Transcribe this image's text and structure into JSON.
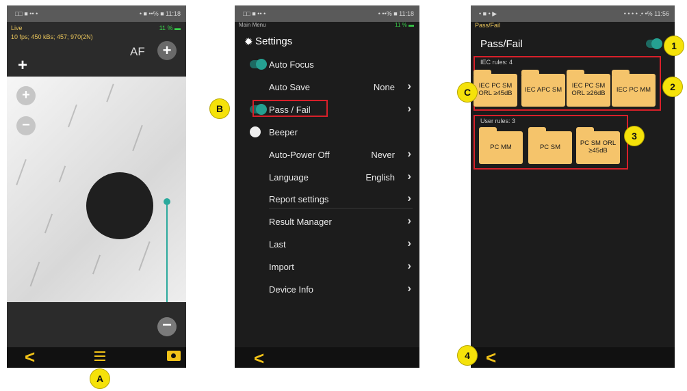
{
  "phoneA": {
    "status_left": "□□ ■ •• •",
    "status_right": "• ■ ••% ■ 11:18",
    "live_label": "Live",
    "battery": "11 % ▬",
    "fps_info": "10 fps; 450 kBs; 457; 970(2N)",
    "af_label": "AF",
    "plus_icon": "+",
    "minus_icon": "−",
    "back_icon": "<"
  },
  "phoneB": {
    "status_left": "□□ ■ •• •",
    "status_right": "• ••% ■ 11:18",
    "menu_label": "Main Menu",
    "battery": "11 % ▬",
    "title": "Settings",
    "items": [
      {
        "label": "Auto Focus",
        "value": "",
        "arrow": ""
      },
      {
        "label": "Auto Save",
        "value": "None",
        "arrow": "›"
      },
      {
        "label": "Pass / Fail",
        "value": "",
        "arrow": "›"
      },
      {
        "label": "Beeper",
        "value": "",
        "arrow": ""
      },
      {
        "label": "Auto-Power Off",
        "value": "Never",
        "arrow": "›"
      },
      {
        "label": "Language",
        "value": "English",
        "arrow": "›"
      },
      {
        "label": "Report settings",
        "value": "",
        "arrow": "›"
      },
      {
        "label": "Result Manager",
        "value": "",
        "arrow": "›"
      },
      {
        "label": "Last",
        "value": "",
        "arrow": "›"
      },
      {
        "label": "Import",
        "value": "",
        "arrow": "›"
      },
      {
        "label": "Device Info",
        "value": "",
        "arrow": "›"
      }
    ],
    "back_icon": "<"
  },
  "phoneC": {
    "status_left": "• ■ • ▶",
    "status_right": "• • • • .• •% 11:56",
    "sub_label": "Pass/Fail",
    "title": "Pass/Fail",
    "iec_label": "IEC rules: 4",
    "iec_rules": [
      "IEC PC SM ORL ≥45dB",
      "IEC APC SM",
      "IEC PC SM ORL ≥26dB",
      "IEC PC MM"
    ],
    "user_label": "User rules: 3",
    "user_rules": [
      "PC MM",
      "PC SM",
      "PC SM ORL ≥45dB"
    ],
    "back_icon": "<"
  },
  "callouts": {
    "a": "A",
    "b": "B",
    "c": "C",
    "n1": "1",
    "n2": "2",
    "n3": "3",
    "n4": "4"
  },
  "colors": {
    "accent": "#f2c318",
    "toggle": "#25a091",
    "highlight": "#d8202a",
    "folder": "#f5c46b",
    "callout": "#f5e20a"
  }
}
